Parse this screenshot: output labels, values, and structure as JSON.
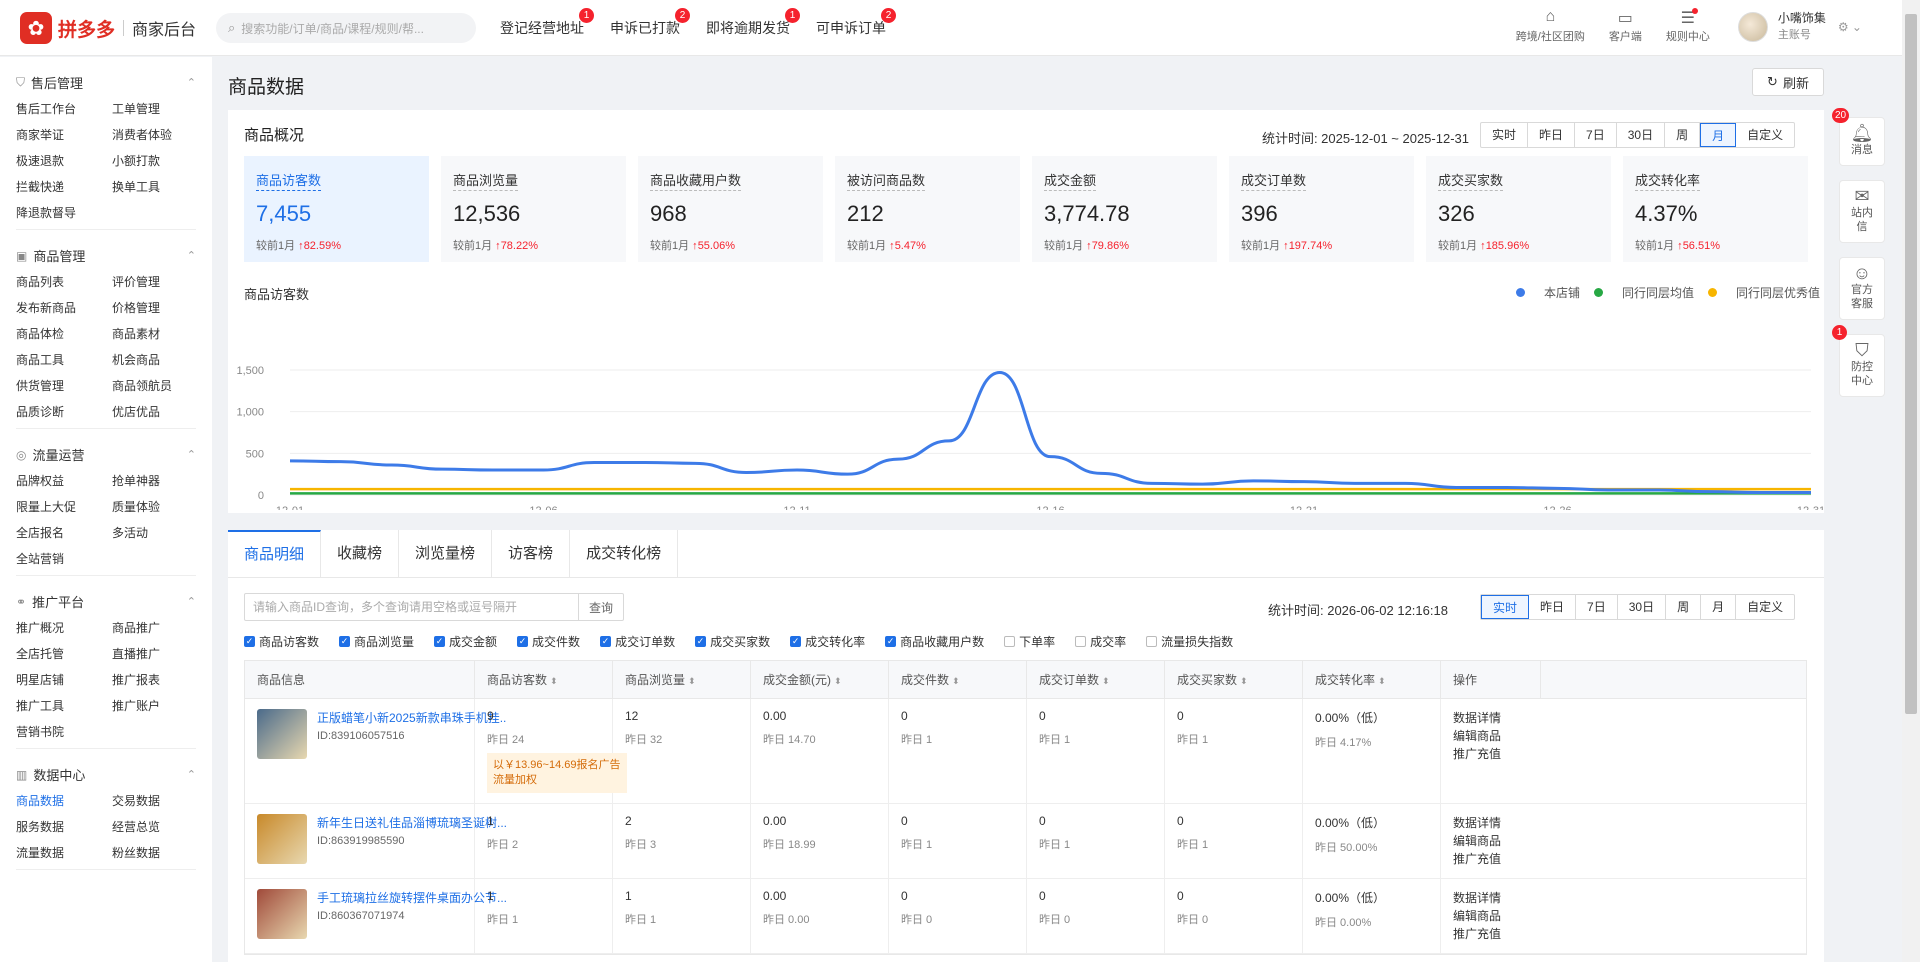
{
  "brand": {
    "logo": "拼多多",
    "sub": "商家后台"
  },
  "search": {
    "placeholder": "搜索功能/订单/商品/课程/规则/帮..."
  },
  "topnav": [
    {
      "label": "登记经营地址",
      "badge": "1"
    },
    {
      "label": "申诉已打款",
      "badge": "2"
    },
    {
      "label": "即将逾期发货",
      "badge": "1"
    },
    {
      "label": "可申诉订单",
      "badge": "2"
    }
  ],
  "topright": [
    {
      "label": "跨境/社区团购",
      "icon": "store-icon"
    },
    {
      "label": "客户端",
      "icon": "monitor-icon"
    },
    {
      "label": "规则中心",
      "icon": "rules-icon"
    }
  ],
  "user": {
    "name": "小嘴饰集",
    "role": "主账号"
  },
  "sidebar": [
    {
      "title": "售后管理",
      "icon": "shield-icon",
      "items": [
        "售后工作台",
        "工单管理",
        "商家举证",
        "消费者体验",
        "极速退款",
        "小额打款",
        "拦截快递",
        "换单工具",
        "降退款督导"
      ]
    },
    {
      "title": "商品管理",
      "icon": "box-icon",
      "items": [
        "商品列表",
        "评价管理",
        "发布新商品",
        "价格管理",
        "商品体检",
        "商品素材",
        "商品工具",
        "机会商品",
        "供货管理",
        "商品领航员",
        "品质诊断",
        "优店优品"
      ]
    },
    {
      "title": "流量运营",
      "icon": "flow-icon",
      "items": [
        "品牌权益",
        "抢单神器",
        "限量上大促",
        "质量体验",
        "全店报名",
        "多活动",
        "全站营销"
      ]
    },
    {
      "title": "推广平台",
      "icon": "share-icon",
      "items": [
        "推广概况",
        "商品推广",
        "全店托管",
        "直播推广",
        "明星店铺",
        "推广报表",
        "推广工具",
        "推广账户",
        "营销书院"
      ]
    },
    {
      "title": "数据中心",
      "icon": "chart-icon",
      "items": [
        "商品数据",
        "交易数据",
        "服务数据",
        "经营总览",
        "流量数据",
        "粉丝数据"
      ]
    }
  ],
  "page": {
    "title": "商品数据",
    "refresh": "刷新"
  },
  "overview": {
    "title": "商品概况",
    "stat_time": "统计时间:  2025-12-01 ~ 2025-12-31",
    "periods": [
      "实时",
      "昨日",
      "7日",
      "30日",
      "周",
      "月",
      "自定义"
    ],
    "active_period": "月",
    "metrics": [
      {
        "name": "商品访客数",
        "value": "7,455",
        "cmp": "较前1月",
        "change": "82.59%"
      },
      {
        "name": "商品浏览量",
        "value": "12,536",
        "cmp": "较前1月",
        "change": "78.22%"
      },
      {
        "name": "商品收藏用户数",
        "value": "968",
        "cmp": "较前1月",
        "change": "55.06%"
      },
      {
        "name": "被访问商品数",
        "value": "212",
        "cmp": "较前1月",
        "change": "5.47%"
      },
      {
        "name": "成交金额",
        "value": "3,774.78",
        "cmp": "较前1月",
        "change": "79.86%"
      },
      {
        "name": "成交订单数",
        "value": "396",
        "cmp": "较前1月",
        "change": "197.74%"
      },
      {
        "name": "成交买家数",
        "value": "326",
        "cmp": "较前1月",
        "change": "185.96%"
      },
      {
        "name": "成交转化率",
        "value": "4.37%",
        "cmp": "较前1月",
        "change": "56.51%"
      }
    ]
  },
  "chart_data": {
    "type": "line",
    "title": "商品访客数",
    "x": [
      "12-01",
      "12-02",
      "12-03",
      "12-04",
      "12-05",
      "12-06",
      "12-07",
      "12-08",
      "12-09",
      "12-10",
      "12-11",
      "12-12",
      "12-13",
      "12-14",
      "12-15",
      "12-16",
      "12-17",
      "12-18",
      "12-19",
      "12-20",
      "12-21",
      "12-22",
      "12-23",
      "12-24",
      "12-25",
      "12-26",
      "12-27",
      "12-28",
      "12-29",
      "12-30",
      "12-31"
    ],
    "xticks": [
      "12-01",
      "12-06",
      "12-11",
      "12-16",
      "12-21",
      "12-26",
      "12-31"
    ],
    "yticks": [
      "0",
      "500",
      "1,000",
      "1,500"
    ],
    "ylim": [
      0,
      1500
    ],
    "legend": "top-right",
    "grid": true,
    "series": [
      {
        "name": "本店铺",
        "color": "#3d7be8",
        "values": [
          410,
          400,
          360,
          310,
          300,
          300,
          390,
          390,
          380,
          270,
          300,
          250,
          430,
          650,
          1470,
          460,
          260,
          140,
          130,
          170,
          160,
          140,
          140,
          90,
          90,
          80,
          60,
          60,
          40,
          30,
          30
        ]
      },
      {
        "name": "同行同层均值",
        "color": "#27a844",
        "values": [
          20,
          20,
          20,
          20,
          20,
          20,
          20,
          20,
          20,
          20,
          20,
          20,
          20,
          20,
          20,
          20,
          20,
          20,
          20,
          20,
          20,
          20,
          20,
          20,
          20,
          20,
          20,
          20,
          20,
          20,
          20
        ]
      },
      {
        "name": "同行同层优秀值",
        "color": "#f7b500",
        "values": [
          70,
          70,
          70,
          70,
          70,
          70,
          70,
          70,
          70,
          70,
          70,
          70,
          70,
          70,
          70,
          70,
          70,
          70,
          70,
          70,
          70,
          70,
          70,
          70,
          70,
          70,
          70,
          70,
          70,
          70,
          70
        ]
      }
    ]
  },
  "detail": {
    "tabs": [
      "商品明细",
      "收藏榜",
      "浏览量榜",
      "访客榜",
      "成交转化榜"
    ],
    "query_placeholder": "请输入商品ID查询，多个查询请用空格或逗号隔开",
    "query_btn": "查询",
    "stat_time": "统计时间:  2026-06-02 12:16:18",
    "periods": [
      "实时",
      "昨日",
      "7日",
      "30日",
      "周",
      "月",
      "自定义"
    ],
    "active_period": "实时",
    "checks": [
      {
        "label": "商品访客数",
        "on": true
      },
      {
        "label": "商品浏览量",
        "on": true
      },
      {
        "label": "成交金额",
        "on": true
      },
      {
        "label": "成交件数",
        "on": true
      },
      {
        "label": "成交订单数",
        "on": true
      },
      {
        "label": "成交买家数",
        "on": true
      },
      {
        "label": "成交转化率",
        "on": true
      },
      {
        "label": "商品收藏用户数",
        "on": true
      },
      {
        "label": "下单率",
        "on": false
      },
      {
        "label": "成交率",
        "on": false
      },
      {
        "label": "流量损失指数",
        "on": false
      }
    ],
    "columns": [
      "商品信息",
      "商品访客数",
      "商品浏览量",
      "成交金额(元)",
      "成交件数",
      "成交订单数",
      "成交买家数",
      "成交转化率",
      "操作"
    ],
    "rows": [
      {
        "title": "正版蜡笔小新2025新款串珠手机挂...",
        "id": "ID:839106057516",
        "v": [
          "9",
          "12",
          "0.00",
          "0",
          "0",
          "0",
          "0.00%（低）"
        ],
        "y": [
          "昨日 24",
          "昨日 32",
          "昨日 14.70",
          "昨日 1",
          "昨日 1",
          "昨日 1",
          "昨日 4.17%"
        ],
        "promo": "以￥13.96~14.69报名广告流量加权",
        "ops": [
          "数据详情",
          "编辑商品",
          "推广充值"
        ],
        "thumb": "#4a6a8a"
      },
      {
        "title": "新年生日送礼佳品淄博琉璃圣诞树...",
        "id": "ID:863919985590",
        "v": [
          "1",
          "2",
          "0.00",
          "0",
          "0",
          "0",
          "0.00%（低）"
        ],
        "y": [
          "昨日 2",
          "昨日 3",
          "昨日 18.99",
          "昨日 1",
          "昨日 1",
          "昨日 1",
          "昨日 50.00%"
        ],
        "promo": "",
        "ops": [
          "数据详情",
          "编辑商品",
          "推广充值"
        ],
        "thumb": "#c8892a"
      },
      {
        "title": "手工琉璃拉丝旋转摆件桌面办公节...",
        "id": "ID:860367071974",
        "v": [
          "1",
          "1",
          "0.00",
          "0",
          "0",
          "0",
          "0.00%（低）"
        ],
        "y": [
          "昨日 1",
          "昨日 1",
          "昨日 0.00",
          "昨日 0",
          "昨日 0",
          "昨日 0",
          "昨日 0.00%"
        ],
        "promo": "",
        "ops": [
          "数据详情",
          "编辑商品",
          "推广充值"
        ],
        "thumb": "#a04a3a"
      }
    ]
  },
  "rfloat": [
    {
      "label": "消息",
      "icon": "bell-icon",
      "badge": "20"
    },
    {
      "label": "站内信",
      "icon": "mail-icon",
      "badge": ""
    },
    {
      "label": "官方客服",
      "icon": "service-icon",
      "badge": ""
    },
    {
      "label": "防控中心",
      "icon": "shield-alert-icon",
      "badge": "1"
    }
  ]
}
